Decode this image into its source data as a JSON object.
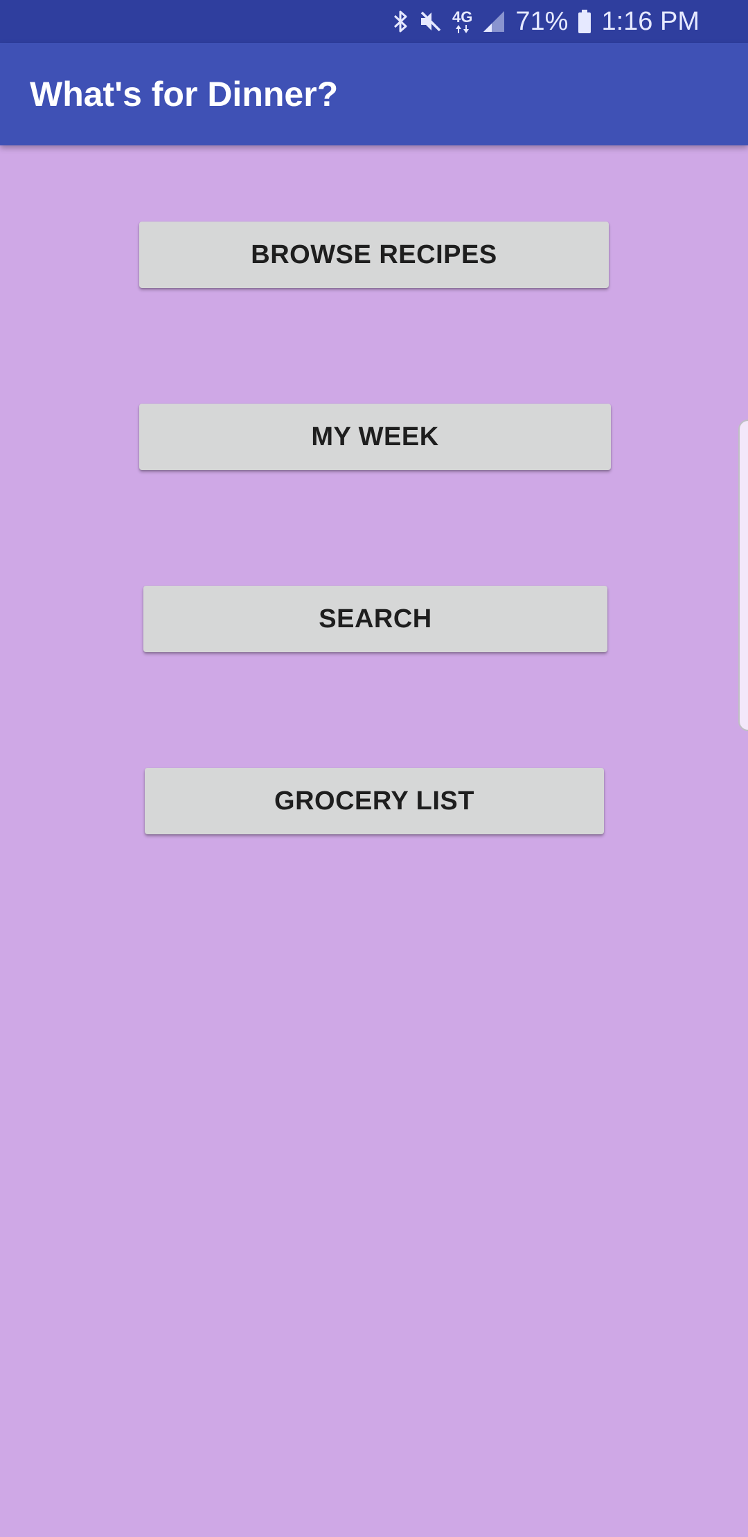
{
  "status_bar": {
    "network": "4G",
    "battery": "71%",
    "time": "1:16 PM",
    "icons": [
      "bluetooth-icon",
      "mute-icon",
      "network-4g-icon",
      "signal-icon",
      "battery-icon"
    ]
  },
  "app_bar": {
    "title": "What's for Dinner?",
    "color": "#3f51b5"
  },
  "menu": {
    "browse_label": "BROWSE RECIPES",
    "week_label": "MY WEEK",
    "search_label": "SEARCH",
    "grocery_label": "GROCERY LIST"
  },
  "colors": {
    "background": "#cfa8e6",
    "status_bar": "#2f3e9e",
    "button": "#d6d7d7"
  }
}
